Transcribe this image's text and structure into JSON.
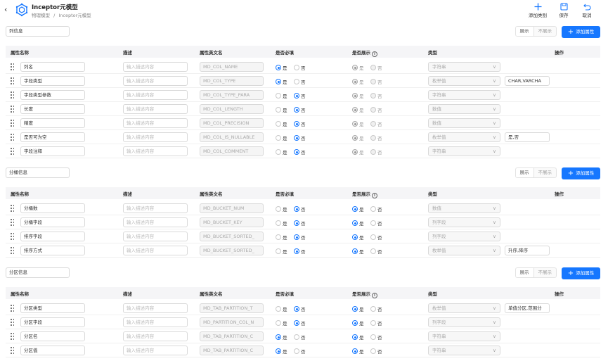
{
  "header": {
    "title": "Inceptor元模型",
    "breadcrumb": [
      "物理模型",
      "/",
      "Inceptor元模型"
    ],
    "toolbar": [
      {
        "label": "添加类别",
        "icon": "plus-icon"
      },
      {
        "label": "保存",
        "icon": "save-icon"
      },
      {
        "label": "取消",
        "icon": "undo-icon"
      }
    ]
  },
  "colors": {
    "accent": "#1677ff",
    "header_bg": "#f5f5f7",
    "border": "#d9d9d9"
  },
  "columns": [
    "属性名称",
    "描述",
    "属性英文名",
    "是否必填",
    "是否展示",
    "类型",
    "操作"
  ],
  "labels": {
    "yes": "是",
    "no": "否",
    "show": "展示",
    "hide": "不展示",
    "add_attr": "添加属性",
    "desc_placeholder": "输入描述内容"
  },
  "sections": [
    {
      "name": "列信息",
      "rows": [
        {
          "name": "列名",
          "en": "MD_COL_NAME",
          "required": true,
          "display": true,
          "type": "字符串",
          "values": ""
        },
        {
          "name": "字段类型",
          "en": "MD_COL_TYPE",
          "required": true,
          "display": true,
          "type": "枚举值",
          "values": "CHAR,VARCHA"
        },
        {
          "name": "字段类型参数",
          "en": "MD_COL_TYPE_PARA",
          "required": false,
          "display": true,
          "type": "字符串",
          "values": ""
        },
        {
          "name": "长度",
          "en": "MD_COL_LENGTH",
          "required": false,
          "display": true,
          "type": "数值",
          "values": ""
        },
        {
          "name": "精度",
          "en": "MD_COL_PRECISION",
          "required": false,
          "display": true,
          "type": "数值",
          "values": ""
        },
        {
          "name": "是否可为空",
          "en": "MD_COL_IS_NULLABLE",
          "required": false,
          "display": true,
          "type": "枚举值",
          "values": "是,否"
        },
        {
          "name": "字段注释",
          "en": "MD_COL_COMMENT",
          "required": false,
          "display": true,
          "type": "字符串",
          "values": ""
        }
      ]
    },
    {
      "name": "分桶信息",
      "rows": [
        {
          "name": "分桶数",
          "en": "MD_BUCKET_NUM",
          "required": false,
          "display": true,
          "type": "数值",
          "values": ""
        },
        {
          "name": "分桶字段",
          "en": "MD_BUCKET_KEY",
          "required": false,
          "display": true,
          "type": "列字段",
          "values": ""
        },
        {
          "name": "排序字段",
          "en": "MD_BUCKET_SORTED_",
          "required": false,
          "display": true,
          "type": "列字段",
          "values": ""
        },
        {
          "name": "排序方式",
          "en": "MD_BUCKET_SORTED_",
          "required": false,
          "display": true,
          "type": "枚举值",
          "values": "升序,降序"
        }
      ]
    },
    {
      "name": "分区信息",
      "rows": [
        {
          "name": "分区类型",
          "en": "MD_TAB_PARTITION_T",
          "required": false,
          "display": true,
          "type": "枚举值",
          "values": "单值分区,范围分"
        },
        {
          "name": "分区字段",
          "en": "MD_PARTITION_COL_N",
          "required": false,
          "display": true,
          "type": "列字段",
          "values": ""
        },
        {
          "name": "分区名",
          "en": "MD_TAB_PARTITION_C",
          "required": true,
          "display": true,
          "type": "字符串",
          "values": ""
        },
        {
          "name": "分区值",
          "en": "MD_TAB_PARTITION_C",
          "required": true,
          "display": true,
          "type": "字符串",
          "values": ""
        }
      ]
    }
  ]
}
